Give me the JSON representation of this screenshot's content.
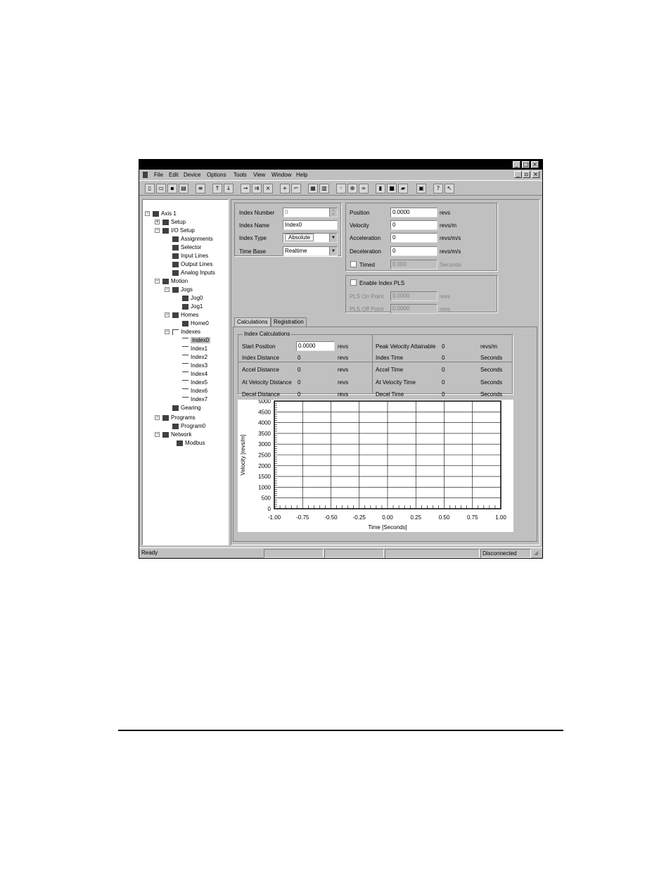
{
  "window": {
    "minimize": "_",
    "maximize": "□",
    "close": "×",
    "restore": "▫"
  },
  "menu": [
    "File",
    "Edit",
    "Device",
    "Options",
    "Tools",
    "View",
    "Window",
    "Help"
  ],
  "toolbar_icons": [
    "new-icon",
    "open-icon",
    "save-icon",
    "print-icon",
    "properties-icon",
    "upload-icon",
    "download-icon",
    "compile-icon",
    "compile-all-icon",
    "cancel-icon",
    "run-icon",
    "stop-motion-icon",
    "copy-config-icon",
    "paste-config-icon",
    "zoom-icon",
    "zoom-in-icon",
    "zoom-out-icon",
    "step-icon",
    "stop-icon",
    "record-icon",
    "view-icon",
    "help-icon",
    "context-help-icon"
  ],
  "tree": {
    "axis": "Axis 1",
    "setup": "Setup",
    "io_setup": "I/O Setup",
    "assignments": "Assignments",
    "selector": "Selector",
    "input_lines": "Input Lines",
    "output_lines": "Output Lines",
    "analog_inputs": "Analog Inputs",
    "motion": "Motion",
    "jogs": "Jogs",
    "jog0": "Jog0",
    "jog1": "Jog1",
    "homes": "Homes",
    "home0": "Home0",
    "indexes": "Indexes",
    "index_items": [
      "Index0",
      "Index1",
      "Index2",
      "Index3",
      "Index4",
      "Index5",
      "Index6",
      "Index7"
    ],
    "gearing": "Gearing",
    "programs": "Programs",
    "program0": "Program0",
    "network": "Network",
    "modbus": "Modbus"
  },
  "index_form": {
    "number_label": "Index Number",
    "number_value": "0",
    "name_label": "Index Name",
    "name_value": "Index0",
    "type_label": "Index Type",
    "type_value": "Absolute",
    "timebase_label": "Time Base",
    "timebase_value": "Realtime"
  },
  "motion_form": {
    "position_label": "Position",
    "position_value": "0.0000",
    "position_unit": "revs",
    "velocity_label": "Velocity",
    "velocity_value": "0",
    "velocity_unit": "revs/m",
    "accel_label": "Acceleration",
    "accel_value": "0",
    "accel_unit": "revs/m/s",
    "decel_label": "Deceleration",
    "decel_value": "0",
    "decel_unit": "revs/m/s",
    "timed_label": "Timed",
    "timed_value": "0.000",
    "timed_unit": "Seconds"
  },
  "pls_form": {
    "enable_label": "Enable Index PLS",
    "on_label": "PLS On Point",
    "on_value": "0.0000",
    "on_unit": "revs",
    "off_label": "PLS Off Point",
    "off_value": "0.0000",
    "off_unit": "revs"
  },
  "tabs": [
    "Calculations",
    "Registration"
  ],
  "calc": {
    "group_title": "Index Calculations",
    "start_pos_label": "Start Position",
    "start_pos_value": "0.0000",
    "start_pos_unit": "revs",
    "index_dist_label": "Index Distance",
    "index_dist_value": "0",
    "index_dist_unit": "revs",
    "accel_dist_label": "Accel Distance",
    "accel_dist_value": "0",
    "accel_dist_unit": "revs",
    "atvel_dist_label": "At Velocity Distance",
    "atvel_dist_value": "0",
    "atvel_dist_unit": "revs",
    "decel_dist_label": "Decel Distance",
    "decel_dist_value": "0",
    "decel_dist_unit": "revs",
    "peak_vel_label": "Peak Velocity Attainable",
    "peak_vel_value": "0",
    "peak_vel_unit": "revs/m",
    "index_time_label": "Index Time",
    "index_time_value": "0",
    "index_time_unit": "Seconds",
    "accel_time_label": "Accel Time",
    "accel_time_value": "0",
    "accel_time_unit": "Seconds",
    "atvel_time_label": "At Velocity Time",
    "atvel_time_value": "0",
    "atvel_time_unit": "Seconds",
    "decel_time_label": "Decel Time",
    "decel_time_value": "0",
    "decel_time_unit": "Seconds"
  },
  "chart_data": {
    "type": "line",
    "xlabel": "Time [Seconds]",
    "ylabel": "Velocity [revs/m]",
    "xlim": [
      -1.0,
      1.0
    ],
    "ylim": [
      0,
      5000
    ],
    "x_ticks": [
      "-1.00",
      "-0.75",
      "-0.50",
      "-0.25",
      "0.00",
      "0.25",
      "0.50",
      "0.75",
      "1.00"
    ],
    "y_ticks": [
      "0",
      "500",
      "1000",
      "1500",
      "2000",
      "2500",
      "3000",
      "3500",
      "4000",
      "4500",
      "5000"
    ],
    "grid": true,
    "series": []
  },
  "status": {
    "ready": "Ready",
    "connection": "Disconnected"
  }
}
